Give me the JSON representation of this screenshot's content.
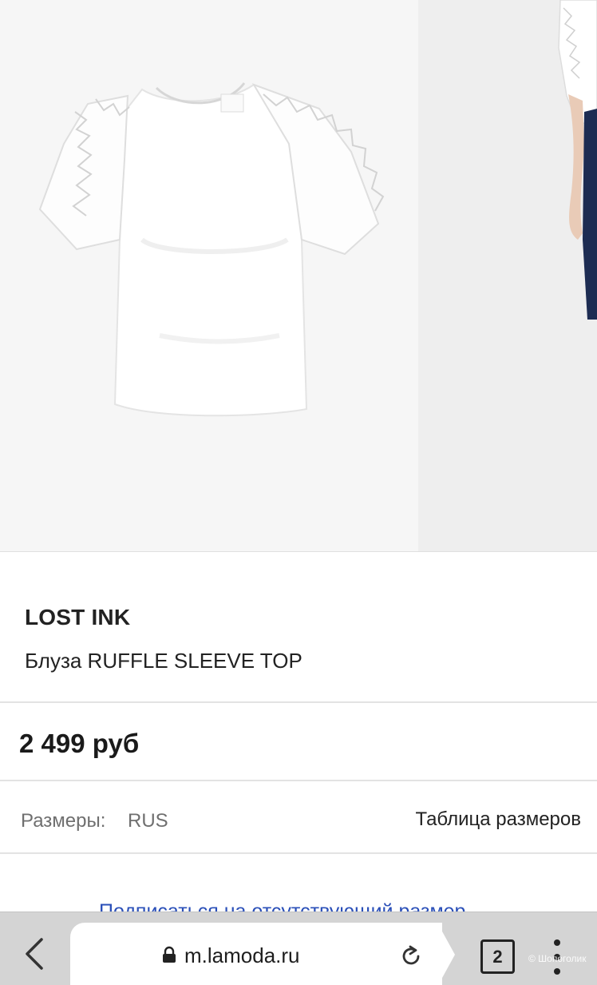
{
  "product": {
    "brand": "LOST INK",
    "name": "Блуза RUFFLE SLEEVE TOP",
    "price": "2 499 руб"
  },
  "sizes": {
    "label": "Размеры:",
    "value": "RUS",
    "table_link": "Таблица размеров"
  },
  "subscribe": {
    "link_text": "Подписаться на отсутствующий размер"
  },
  "browser": {
    "url": "m.lamoda.ru",
    "tab_count": "2",
    "watermark": "© Шопоголик"
  },
  "colors": {
    "link": "#2a4fb8",
    "toolbar": "#d4d4d4",
    "text": "#222222"
  }
}
